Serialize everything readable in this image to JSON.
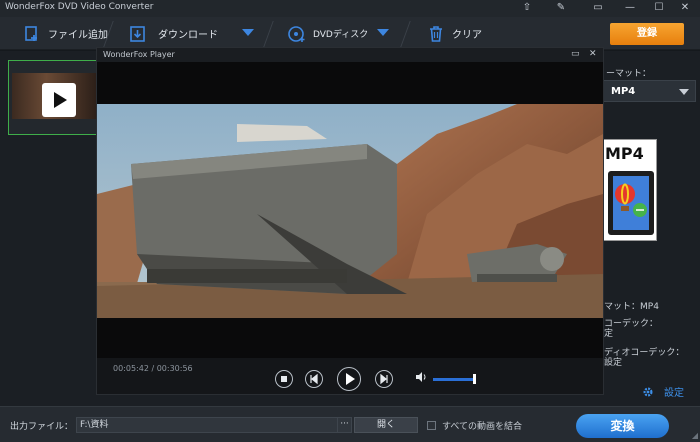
{
  "window": {
    "title": "WonderFox DVD Video Converter"
  },
  "toolbar": {
    "add_file": "ファイル追加",
    "download": "ダウンロード",
    "dvd_disc": "DVDディスク",
    "clear": "クリア",
    "register": "登録"
  },
  "player": {
    "title": "WonderFox Player",
    "time": "00:05:42 / 00:30:56",
    "volume": 0.95
  },
  "format_panel": {
    "label": "ーマット：",
    "selected": "MP4",
    "card_label": "MP4",
    "info_format": "マット：MP4",
    "video_codec": "コーデック：",
    "video_codec_value": "定",
    "audio_codec": "ディオコーデック：",
    "audio_codec_value": "設定",
    "settings": "設定"
  },
  "bottom": {
    "output_label": "出力ファイル：",
    "output_path": "F:\\資料",
    "browse": "···",
    "open": "開く",
    "merge": "すべての動画を結合",
    "convert": "変換"
  },
  "colors": {
    "accent": "#3d86e0",
    "register": "#f29a22",
    "convert": "#2f86e0",
    "selected_border": "#3fae4a"
  }
}
